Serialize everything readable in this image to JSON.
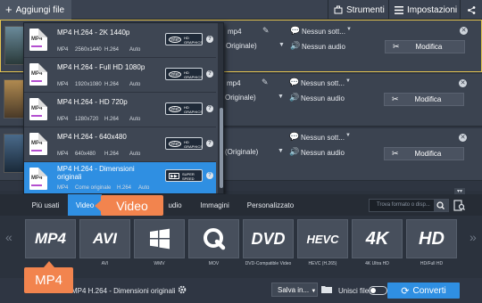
{
  "toolbar": {
    "add_files_label": "Aggiungi file",
    "tools_label": "Strumenti",
    "preferences_label": "Impostazioni"
  },
  "files": [
    {
      "format_label": "mp4",
      "format_value": "Originale)",
      "audio": "Nessun audio",
      "subtitles": "Nessun sott...",
      "edit_label": "Modifica",
      "selected": true
    },
    {
      "format_label": "mp4",
      "format_value": "Originale)",
      "audio": "Nessun audio",
      "subtitles": "Nessun sott...",
      "edit_label": "Modifica",
      "selected": false
    },
    {
      "format_label": "",
      "format_value": "(Originale)",
      "audio": "Nessun audio",
      "subtitles": "Nessun sott...",
      "edit_label": "Modifica",
      "selected": false
    }
  ],
  "preset_dropdown": {
    "items": [
      {
        "name": "MP4 H.264 - 2K 1440p",
        "container": "MP4",
        "resolution": "2560x1440",
        "codec": "H.264",
        "quality": "Auto",
        "badge": "intel HD GRAPHICS",
        "active": false
      },
      {
        "name": "MP4 H.264 - Full HD 1080p",
        "container": "MP4",
        "resolution": "1920x1080",
        "codec": "H.264",
        "quality": "Auto",
        "badge": "intel HD GRAPHICS",
        "active": false
      },
      {
        "name": "MP4 H.264 - HD 720p",
        "container": "MP4",
        "resolution": "1280x720",
        "codec": "H.264",
        "quality": "Auto",
        "badge": "intel HD GRAPHICS",
        "active": false
      },
      {
        "name": "MP4 H.264 - 640x480",
        "container": "MP4",
        "resolution": "640x480",
        "codec": "H.264",
        "quality": "Auto",
        "badge": "intel HD GRAPHICS",
        "active": false
      },
      {
        "name": "MP4 H.264 - Dimensioni originali",
        "container": "MP4",
        "resolution": "Come originale",
        "codec": "H.264",
        "quality": "Auto",
        "badge": "SUPER SPEED",
        "active": true
      }
    ],
    "file_icon_label": "MP4"
  },
  "tabs": [
    {
      "label": "Più usati",
      "active": false
    },
    {
      "label": "Video",
      "active": true
    },
    {
      "label": "udio",
      "active": false
    },
    {
      "label": "Immagini",
      "active": false
    },
    {
      "label": "Personalizzato",
      "active": false
    }
  ],
  "search_placeholder": "Trova formato o disp...",
  "formats": [
    {
      "logo": "MP4",
      "caption": ""
    },
    {
      "logo": "AVI",
      "caption": "AVI"
    },
    {
      "logo": "WMV",
      "caption": "WMV"
    },
    {
      "logo": "MOV",
      "caption": "MOV"
    },
    {
      "logo": "DVD",
      "caption": "DVD-Compatible Video"
    },
    {
      "logo": "HEVC",
      "caption": "HEVC (H.265)"
    },
    {
      "logo": "4K",
      "caption": "4K Ultra HD"
    },
    {
      "logo": "HD",
      "caption": "HD/Full HD"
    }
  ],
  "bottom": {
    "output_format": "MP4 H.264 - Dimensioni originali",
    "save_label": "Salva in...",
    "merge_label": "Unisci file",
    "convert_label": "Converti"
  },
  "callouts": {
    "video": "Video",
    "mp4": "MP4"
  },
  "colors": {
    "accent": "#2f8fe2",
    "callout": "#f2844e",
    "selection": "#e4c350"
  }
}
